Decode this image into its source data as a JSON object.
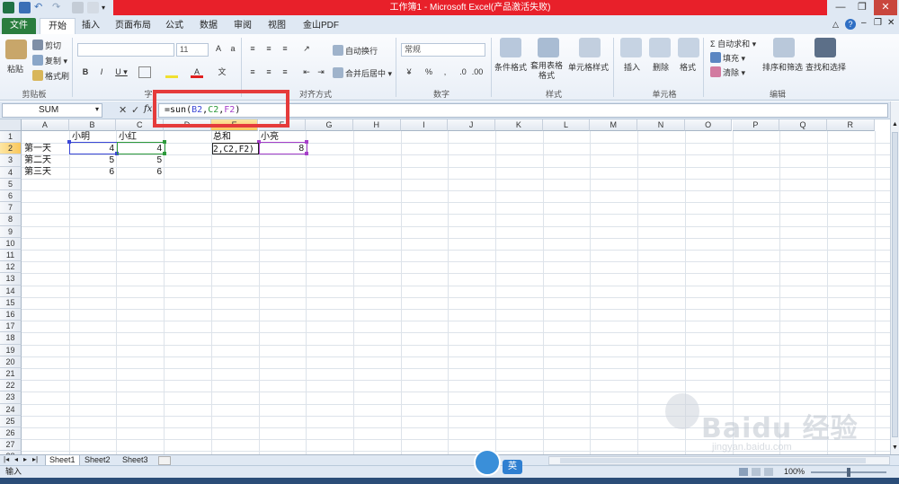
{
  "window": {
    "title": "工作簿1 - Microsoft Excel(产品激活失败)",
    "minimize": "—",
    "restore": "❐",
    "close": "✕",
    "help": "?"
  },
  "tabs": [
    "文件",
    "开始",
    "插入",
    "页面布局",
    "公式",
    "数据",
    "审阅",
    "视图",
    "金山PDF"
  ],
  "ribbon": {
    "clipboard": {
      "paste": "粘贴",
      "cut": "剪切",
      "copy": "复制 ▾",
      "format_painter": "格式刷",
      "label": "剪贴板"
    },
    "font": {
      "name": "",
      "size": "11",
      "bold": "B",
      "italic": "I",
      "underline": "U ▾",
      "label": "字"
    },
    "alignment": {
      "wrap": "自动换行",
      "merge": "合并后居中 ▾",
      "label": "对齐方式"
    },
    "number": {
      "format": "常规",
      "percent": "%",
      "comma": ",",
      "label": "数字"
    },
    "styles": {
      "conditional": "条件格式",
      "table": "套用表格格式",
      "cell": "单元格样式",
      "label": "样式"
    },
    "cells": {
      "insert": "插入",
      "delete": "删除",
      "format": "格式",
      "label": "单元格"
    },
    "editing": {
      "autosum": "Σ 自动求和 ▾",
      "fill": "填充 ▾",
      "clear": "清除 ▾",
      "sort": "排序和筛选",
      "find": "查找和选择",
      "label": "编辑"
    }
  },
  "formula_bar": {
    "name_box": "SUM",
    "cancel": "✕",
    "enter": "✓",
    "fx": "fx",
    "formula_prefix": "=sun(",
    "ref1": "B2",
    "comma1": ",",
    "ref2": "C2",
    "comma2": ",",
    "ref3": "F2",
    "formula_suffix": ")"
  },
  "columns": [
    "A",
    "B",
    "C",
    "D",
    "E",
    "F",
    "G",
    "H",
    "I",
    "J",
    "K",
    "L",
    "M",
    "N",
    "O",
    "P",
    "Q",
    "R"
  ],
  "rows": [
    "1",
    "2",
    "3",
    "4",
    "5",
    "6",
    "7",
    "8",
    "9",
    "10",
    "11",
    "12",
    "13",
    "14",
    "15",
    "16",
    "17",
    "18",
    "19",
    "20",
    "21",
    "22",
    "23",
    "24",
    "25",
    "26",
    "27",
    "28"
  ],
  "cells": {
    "B1": "小明",
    "C1": "小红",
    "E1": "总和",
    "F1": "小亮",
    "A2": "第一天",
    "B2": "4",
    "C2": "4",
    "E2": "2,C2,F2)",
    "F2": "8",
    "A3": "第二天",
    "B3": "5",
    "C3": "5",
    "A4": "第三天",
    "B4": "6",
    "C4": "6"
  },
  "sheets": [
    "Sheet1",
    "Sheet2",
    "Sheet3"
  ],
  "status": {
    "mode": "输入",
    "zoom": "100%",
    "ime": "英"
  },
  "watermark": {
    "logo": "Baidu 经验",
    "url": "jingyan.baidu.com"
  },
  "colors": {
    "ref_b": "#3b47d6",
    "ref_c": "#2d9a3a",
    "ref_f": "#a63fc9",
    "highlight": "#e53b3b",
    "excel_green": "#2a7d3e"
  }
}
